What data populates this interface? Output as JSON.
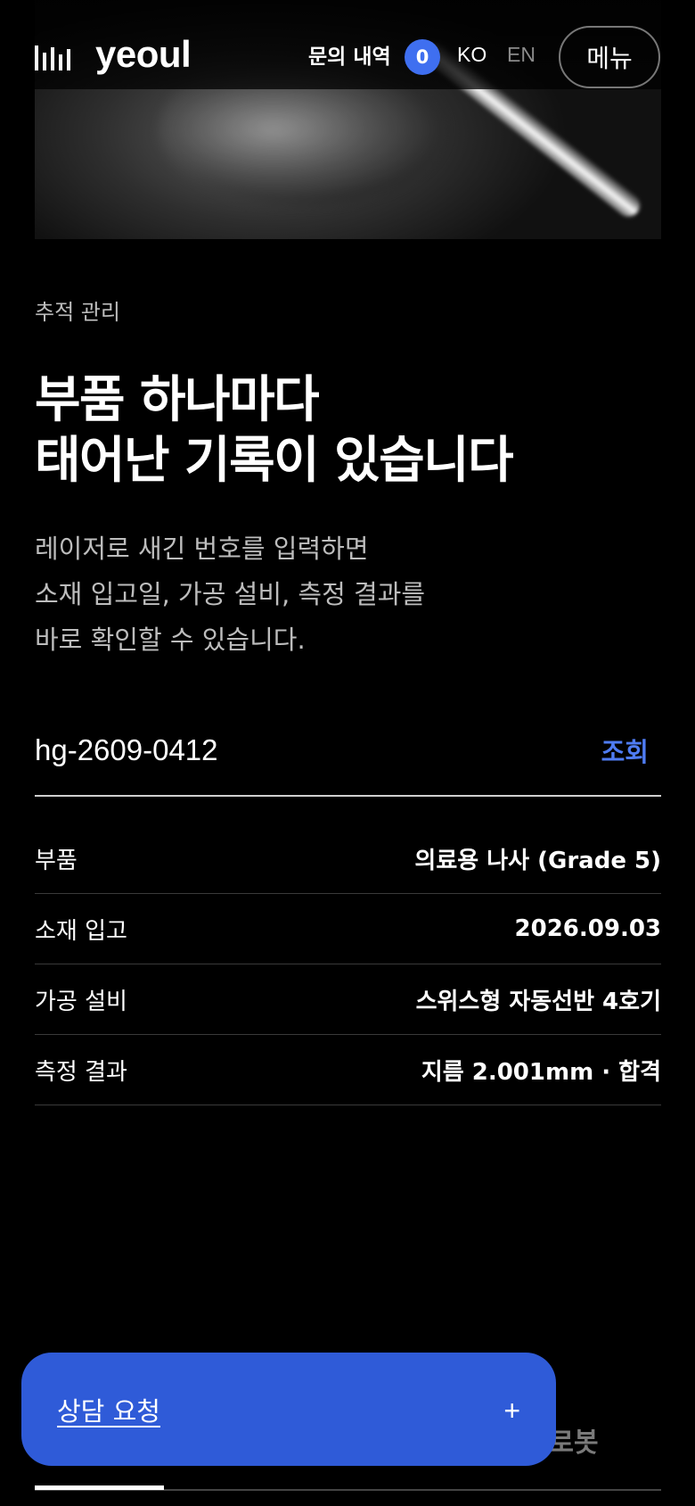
{
  "header": {
    "brand": "yeoul",
    "inquiries_label": "문의 내역",
    "inquiries_count": "0",
    "lang_ko": "KO",
    "lang_en": "EN",
    "menu_label": "메뉴"
  },
  "section": {
    "eyebrow": "추적 관리",
    "headline_line1": "부품 하나마다",
    "headline_line2": "태어난 기록이 있습니다",
    "desc_line1": "레이저로 새긴 번호를 입력하면",
    "desc_line2": "소재 입고일, 가공 설비, 측정 결과를",
    "desc_line3": "바로 확인할 수 있습니다."
  },
  "search": {
    "value": "hg-2609-0412",
    "button_label": "조회"
  },
  "details": [
    {
      "label": "부품",
      "value": "의료용 나사 (Grade 5)"
    },
    {
      "label": "소재 입고",
      "value": "2026.09.03"
    },
    {
      "label": "가공 설비",
      "value": "스위스형 자동선반 4호기"
    },
    {
      "label": "측정 결과",
      "value": "지름 2.001mm · 합격"
    }
  ],
  "partial_behind_text": "·로봇",
  "cta": {
    "label": "상담 요청",
    "plus": "+"
  },
  "colors": {
    "accent": "#2f5bd8",
    "badge": "#3f6ff0",
    "link": "#4f7cf3",
    "background": "#000000"
  }
}
